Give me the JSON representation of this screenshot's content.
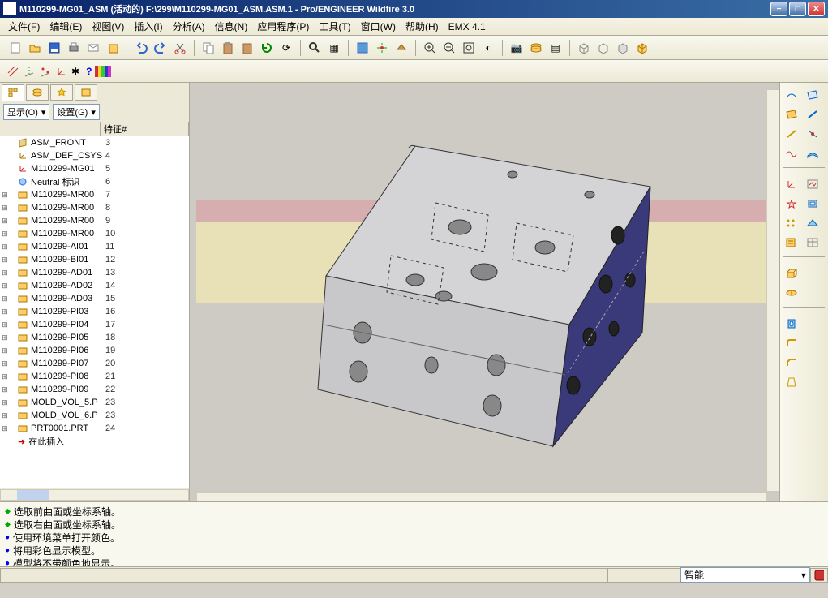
{
  "window": {
    "title": "M110299-MG01_ASM (活动的) F:\\299\\M110299-MG01_ASM.ASM.1 - Pro/ENGINEER Wildfire 3.0"
  },
  "menu": {
    "items": [
      "文件(F)",
      "编辑(E)",
      "视图(V)",
      "插入(I)",
      "分析(A)",
      "信息(N)",
      "应用程序(P)",
      "工具(T)",
      "窗口(W)",
      "帮助(H)",
      "EMX 4.1"
    ]
  },
  "sidebar": {
    "show_label": "显示(O)",
    "settings_label": "设置(G)",
    "feature_header": "特征#",
    "insert_here": "在此插入",
    "tree": [
      {
        "expand": "",
        "icon": "datum",
        "name": "ASM_FRONT",
        "feat": "3"
      },
      {
        "expand": "",
        "icon": "csys",
        "name": "ASM_DEF_CSYS",
        "feat": "4"
      },
      {
        "expand": "",
        "icon": "csys-red",
        "name": "M110299-MG01",
        "feat": "5"
      },
      {
        "expand": "",
        "icon": "neutral",
        "name": "Neutral 标识",
        "feat": "6"
      },
      {
        "expand": "+",
        "icon": "part",
        "name": "M110299-MR00",
        "feat": "7"
      },
      {
        "expand": "+",
        "icon": "part",
        "name": "M110299-MR00",
        "feat": "8"
      },
      {
        "expand": "+",
        "icon": "part",
        "name": "M110299-MR00",
        "feat": "9"
      },
      {
        "expand": "+",
        "icon": "part",
        "name": "M110299-MR00",
        "feat": "10"
      },
      {
        "expand": "+",
        "icon": "part",
        "name": "M110299-AI01",
        "feat": "11"
      },
      {
        "expand": "+",
        "icon": "part",
        "name": "M110299-BI01",
        "feat": "12"
      },
      {
        "expand": "+",
        "icon": "part",
        "name": "M110299-AD01",
        "feat": "13"
      },
      {
        "expand": "+",
        "icon": "part",
        "name": "M110299-AD02",
        "feat": "14"
      },
      {
        "expand": "+",
        "icon": "part",
        "name": "M110299-AD03",
        "feat": "15"
      },
      {
        "expand": "+",
        "icon": "part",
        "name": "M110299-PI03",
        "feat": "16"
      },
      {
        "expand": "+",
        "icon": "part",
        "name": "M110299-PI04",
        "feat": "17"
      },
      {
        "expand": "+",
        "icon": "part",
        "name": "M110299-PI05",
        "feat": "18"
      },
      {
        "expand": "+",
        "icon": "part",
        "name": "M110299-PI06",
        "feat": "19"
      },
      {
        "expand": "+",
        "icon": "part",
        "name": "M110299-PI07",
        "feat": "20"
      },
      {
        "expand": "+",
        "icon": "part",
        "name": "M110299-PI08",
        "feat": "21"
      },
      {
        "expand": "+",
        "icon": "part",
        "name": "M110299-PI09",
        "feat": "22"
      },
      {
        "expand": "+",
        "icon": "part",
        "name": "MOLD_VOL_5.P",
        "feat": "23"
      },
      {
        "expand": "+",
        "icon": "part",
        "name": "MOLD_VOL_6.P",
        "feat": "23"
      },
      {
        "expand": "+",
        "icon": "part",
        "name": "PRT0001.PRT",
        "feat": "24"
      }
    ]
  },
  "messages": {
    "lines": [
      {
        "bullet": "green",
        "text": "选取前曲面或坐标系轴。"
      },
      {
        "bullet": "green",
        "text": "选取右曲面或坐标系轴。"
      },
      {
        "bullet": "blue",
        "text": "使用环境菜单打开颜色。"
      },
      {
        "bullet": "blue",
        "text": "将用彩色显示模型。"
      },
      {
        "bullet": "blue",
        "text": "模型将不带颜色地显示。"
      }
    ]
  },
  "statusbar": {
    "filter_label": "智能"
  }
}
